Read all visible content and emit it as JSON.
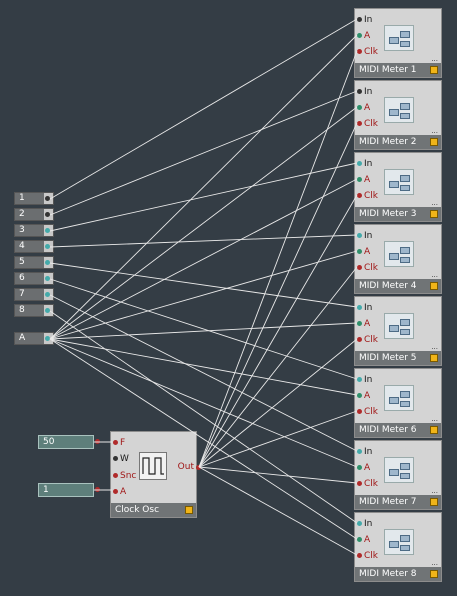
{
  "channel_labels": [
    "1",
    "2",
    "3",
    "4",
    "5",
    "6",
    "7",
    "8"
  ],
  "amp_label": "A",
  "knobs": {
    "freq_value": "50",
    "amp_value": "1"
  },
  "clock_osc": {
    "title": "Clock Osc",
    "ports": {
      "f": "F",
      "w": "W",
      "snc": "Snc",
      "a": "A",
      "out": "Out"
    }
  },
  "meter_ports": {
    "in": "In",
    "a": "A",
    "clk": "Clk"
  },
  "meters": [
    {
      "title": "MIDI Meter 1"
    },
    {
      "title": "MIDI Meter 2"
    },
    {
      "title": "MIDI Meter 3"
    },
    {
      "title": "MIDI Meter 4"
    },
    {
      "title": "MIDI Meter 5"
    },
    {
      "title": "MIDI Meter 6"
    },
    {
      "title": "MIDI Meter 7"
    },
    {
      "title": "MIDI Meter 8"
    }
  ],
  "colors": {
    "background": "#343d45",
    "wire": "#e8e8e8",
    "led": "#f0b418",
    "port_red": "#b02a2a"
  },
  "icons": {
    "meter_icon": "meter-display-icon",
    "clock_icon": "square-wave-icon"
  }
}
